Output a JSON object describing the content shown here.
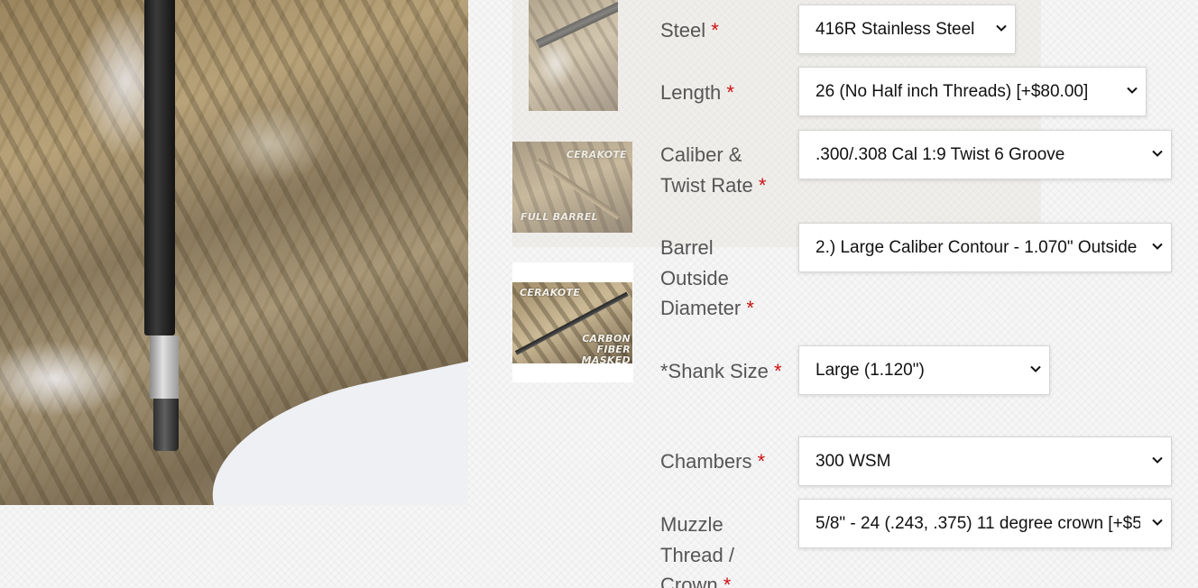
{
  "gallery": {
    "thumbnails": [
      {
        "caption_top": "",
        "caption_bottom": ""
      },
      {
        "caption_top": "CERAKOTE",
        "caption_bottom": "FULL BARREL"
      },
      {
        "caption_top": "CERAKOTE",
        "caption_bottom": "CARBON FIBER MASKED"
      }
    ]
  },
  "form": {
    "required_marker": "*",
    "fields": [
      {
        "label": "Steel",
        "value": "416R Stainless Steel"
      },
      {
        "label": "Length",
        "value": "26 (No Half inch Threads) [+$80.00]"
      },
      {
        "label": "Caliber & Twist Rate",
        "value": ".300/.308 Cal 1:9 Twist 6 Groove"
      },
      {
        "label": "Barrel Outside Diameter",
        "value": "2.) Large Caliber Contour - 1.070\" Outside"
      },
      {
        "label": "*Shank Size",
        "value": "Large (1.120\")"
      },
      {
        "label": "Chambers",
        "value": "300 WSM"
      },
      {
        "label": "Muzzle Thread / Crown",
        "value": "5/8\" - 24 (.243, .375) 11 degree crown [+$5"
      }
    ]
  },
  "icons": {
    "dropdown": "chevron-down-icon"
  }
}
